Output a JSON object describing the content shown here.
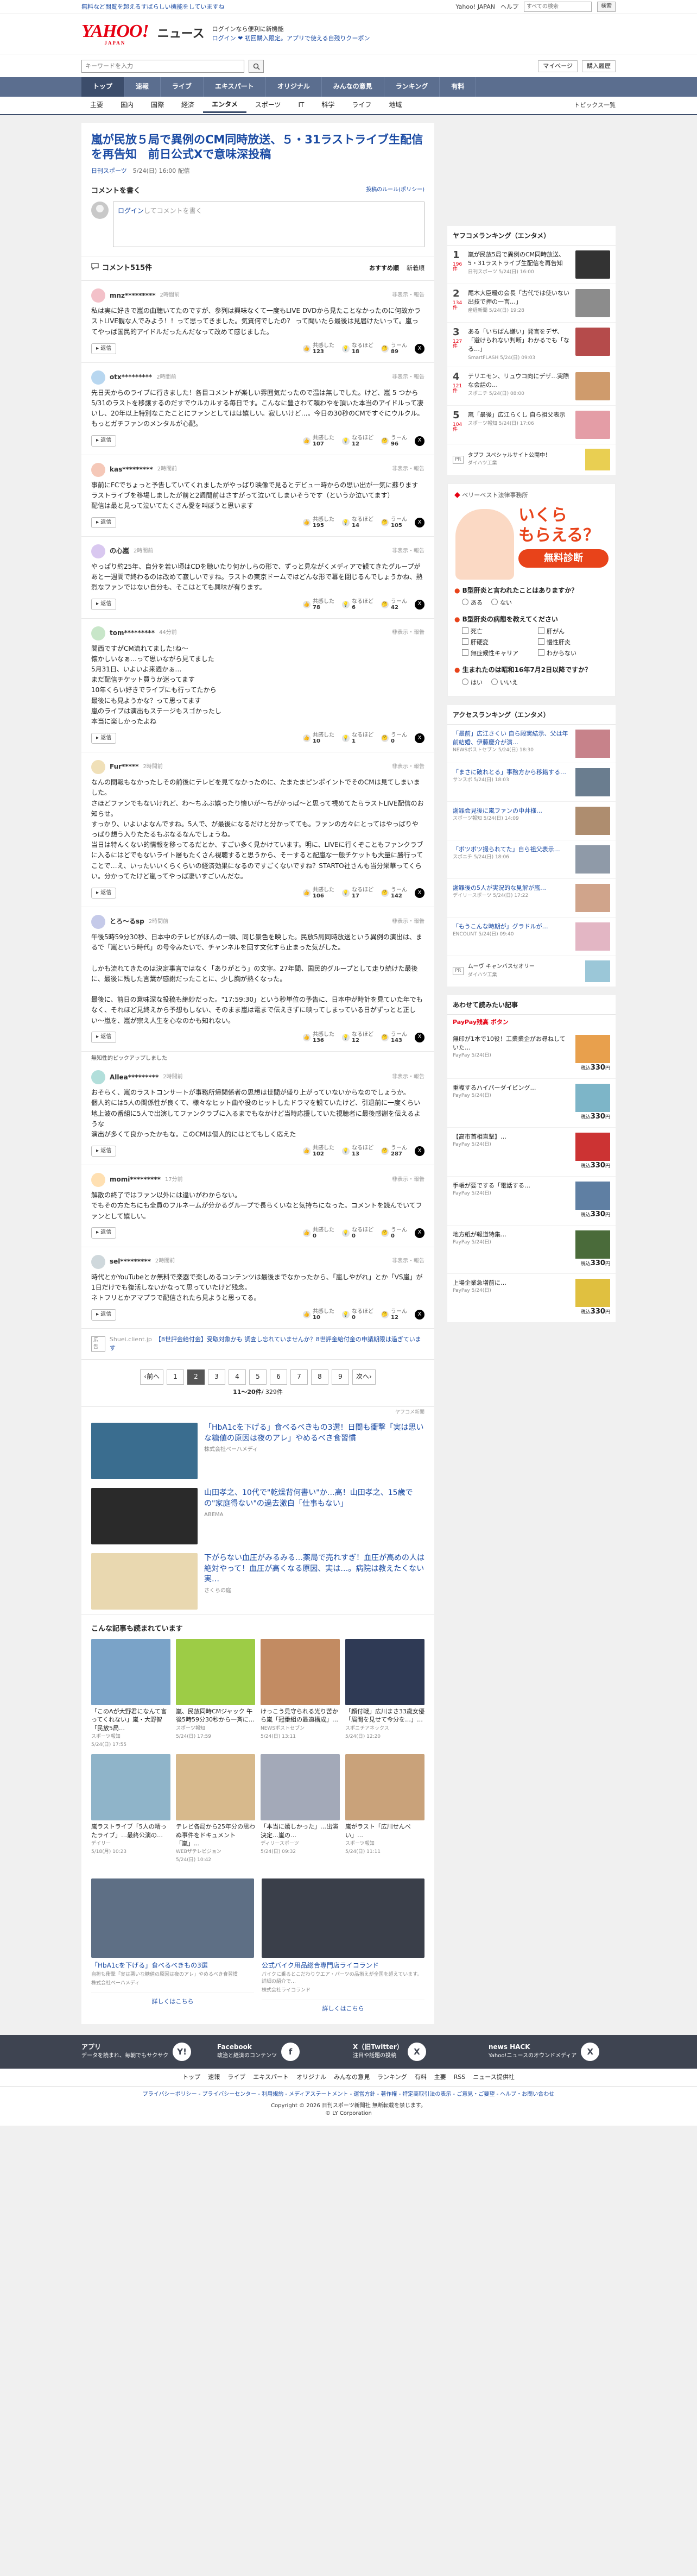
{
  "topbar": {
    "notice": "無料など閲覧を超えるすばらしい機能をしていますね",
    "links": [
      "Yahoo! JAPAN",
      "ヘルプ"
    ],
    "search_placeholder": "すべての検索",
    "search_button": "検索"
  },
  "header": {
    "logo": "YAHOO!",
    "logo_sub": "JAPAN",
    "section": "ニュース",
    "promo1": "ログインなら便利に新機能",
    "promo2": "ログイン ❤ 初回購入限定。アプリで使える自残りクーポン",
    "promo3": ""
  },
  "searchrow": {
    "placeholder": "キーワードを入力",
    "right": [
      "マイページ",
      "購入履歴"
    ]
  },
  "gnav": [
    "トップ",
    "速報",
    "ライブ",
    "エキスパート",
    "オリジナル",
    "みんなの意見",
    "ランキング",
    "有料"
  ],
  "snav": [
    "主要",
    "国内",
    "国際",
    "経済",
    "エンタメ",
    "スポーツ",
    "IT",
    "科学",
    "ライフ",
    "地域"
  ],
  "snav_right": "トピックス一覧",
  "article": {
    "title": "嵐が民放５局で異例のCM同時放送、５・31ラストライブ生配信を再告知　前日公式Xで意味深投稿",
    "source": "日刊スポーツ",
    "date": "5/24(日) 16:00 配信"
  },
  "comment_write": {
    "heading": "コメントを書く",
    "policy_link": "投稿のルール(ポリシー)",
    "login": "ログイン",
    "placeholder": "してコメントを書く"
  },
  "comments_head": {
    "count": "コメント515件",
    "sort": [
      "おすすめ順",
      "新着順"
    ]
  },
  "labels": {
    "reply": "返信",
    "report": "非表示・報告",
    "v1": "共感した",
    "v2": "なるほど",
    "v3": "うーん",
    "expert_note": "無知性的ピックアップしました"
  },
  "comments": [
    {
      "name": "mnz*********",
      "time": "2時間前",
      "text": "私は実に好きで嵐の曲聴いてたのですが、参列は興味なくて一度もLIVE DVDから見たことなかったのに何故かラストLIVE観な人でみよう！！って思ってきました。気質何でしたの？ って聞いたら最後は見届けたいって。嵐ってやっぱ国民的アイドルだったんだなって改めて感じました。",
      "v": [
        "123",
        "18",
        "89"
      ],
      "color": "#f3c1c9"
    },
    {
      "name": "otx*********",
      "time": "2時間前",
      "text": "先日天からのライブに行きました！各目コメントが楽しい雰囲気だったので温は無しでした。けど、嵐 5 つから5/31のラストを移譲するのだすでウルカルする毎日です。こんなに豊さわて頼わやを頂いた本当のアイドルって凄いし、20年以上特別なこたことにファンとしてはは嬉しい。寂しいけど…。今日の30秒のCMですぐにウルクル。もっとガチファンのメンタルが心配。",
      "v": [
        "107",
        "12",
        "96"
      ],
      "color": "#b8d7f0"
    },
    {
      "name": "kas*********",
      "time": "2時間前",
      "text": "事前にFCでちょっと予告していてくれましたがやっぱり映像で見るとデビュー時からの思い出が一気に蘇ります\nラストライブを移場しましたが前と2週間前はさすがって泣いてしまいそうです（というか泣いてます）\n配信は最と見って泣いてたくさん愛を叫ぼうと思います",
      "v": [
        "195",
        "14",
        "105"
      ],
      "color": "#f5c8b8"
    },
    {
      "name": "の心嵐",
      "time": "2時間前",
      "text": "やっぱり約25年、自分を若い頃はCDを聴いたり何かしらの形で、ずっと見ながくメディアで観てきたグループがあと一週間で終わるのは改めて寂しいですね。ラストの東京ドームではどんな形で幕を閉じるんでしょうかね、熱烈なファンではない自分も、そこはとても興味が有ります。",
      "v": [
        "78",
        "6",
        "42"
      ],
      "color": "#d9c8f0"
    },
    {
      "name": "tom*********",
      "time": "44分前",
      "text": "関西ですがCM流れてました!ね〜\n懐かしいなぁ…って思いながら見てました\n5月31日、いよいよ来週かぁ…\nまだ配信チケット買うか迷ってます\n10年くらい好きでライブにも行ってたから\n最後にも見ようかな？って思ってます\n嵐のライブは演出もステージもスゴかったし\n本当に楽しかったよね",
      "v": [
        "10",
        "1",
        "0"
      ],
      "color": "#c8e6c9"
    },
    {
      "name": "Fur*****",
      "time": "2時間前",
      "text": "なんの間報もなかったしその前後にテレビを見てなかったのに、たまたまピンポイントでそのCMは見てしまいました。\nさほどファンでもないけれど、わ〜ちふぶ嬉ったり懐いが〜ちがかっぱ〜と思って視めてたらラストLIVE配信のお知らせ。\nすっかり、いよいよなんですね。5人で、が最後になるだけと分かってても。ファンの方々にとってはやっぱりやっぱり想う入りたたるもぶなるなんでしょうね。\n当日は特んくない的情報を移ってるだとか、すごい多く見かけています。明に、LIVEに行くぞこともファンクラブに入るにはどでもないライト層もたくさん視聴すると思うから、そーすると配嵐な一般チケットも大量に勝行ってことで…え、いったいいくらくらいの経済効果になるのですごくないですね？STARTO社さんも当分栄華ってくらい。分かってたけど嵐ってやっぱ凄いすごいんだな。",
      "v": [
        "106",
        "17",
        "142"
      ],
      "color": "#f0e0b8"
    },
    {
      "name": "とろ〜るsp",
      "time": "2時間前",
      "text": "午後5時59分30秒、日本中のテレビがほんの一瞬、同じ景色を映した。民放5局同時放送という異例の演出は、まるで「嵐という時代」の号令みたいで、チャンネルを回す文化すら止まった気がした。\n\nしかも流れてきたのは決定事言ではなく「ありがとう」の文字。27年間、国民的グループとして走り続けた最後に、最後に残した言葉が感謝だったことに、少し胸が熱くなった。\n\n最後に、前日の意味深な投稿も絶妙だった。\"17:59:30」という秒単位の予告に、日本中が時計を見ていた年でもなく、それほど見終えから予想もしない、そのまま嵐は電まで伝えきずに映ってしまっている日がずっとと正しい〜嵐を、嵐が宗え人生を心なのかも知れない。",
      "v": [
        "136",
        "12",
        "143"
      ],
      "color": "#c5cae9"
    },
    {
      "name": "Allea*********",
      "time": "2時間前",
      "text": "おそらく、嵐のラストコンサートが事務所帰関係者の思想は世間が盛り上がっていないからなのでしょうか。\n個人的には5人の関係性が良くて、様々なヒット曲や役のヒットしたドラマを観ていたけど、引退前に一度くらい地上波の番組に5人で出演してファンクラブに入るまでもなかけど当時応援していた視聴者に最後感謝を伝えるような\n演出が多くて良かったかもな。このCMは個人的にはとてもしく応えた",
      "v": [
        "102",
        "13",
        "287"
      ],
      "color": "#b2dfdb"
    },
    {
      "name": "momi*********",
      "time": "17分前",
      "text": "解散の終了ではファン以外には違いがわからない。\nでもその方たちにも全員のフルネームが分かるグループで長らくいなと気持ちになった。コメントを読んでいてファンとして嬉しい。",
      "v": [
        "0",
        "0",
        "0"
      ],
      "color": "#ffe0b2"
    },
    {
      "name": "sel*********",
      "time": "2時間前",
      "text": "時代とかYouTubeとか無料で楽器で楽しめるコンテンツは最後までなかったから、「嵐しやがれ」とか「VS嵐」が1日だけでも復活しないかなって思っていたけど残念。\nネトフリとかアマプラで配信されたら見ようと思ってる。",
      "v": [
        "10",
        "0",
        "12"
      ],
      "color": "#cfd8dc"
    }
  ],
  "inline_ad": {
    "label": "Shuei.client.jp",
    "text": "【8世評金給付金】受取対象かも 調査し忘れていませんか？8世評金給付金の申請期限は過ぎています"
  },
  "pager": {
    "prev": "前へ",
    "next": "次へ",
    "pages": [
      "1",
      "2",
      "3",
      "4",
      "5",
      "6",
      "7",
      "8",
      "9"
    ],
    "current": "2",
    "count": "11〜20件",
    "total": "/ 329件"
  },
  "sponsored": {
    "label": "ヤフコメ新聞",
    "items": [
      {
        "title": "「HbA1cを下げる」食べるべきもの3選！日間も衝撃「実は思いな糖値の原因は夜のアレ」やめるべき食習慣",
        "src": "株式会社ベーハメディ",
        "color": "#3a6d8f"
      },
      {
        "title": "山田孝之、10代で\"乾燥背何書い\"か…高！山田孝之、15歳での\"家庭得ない\"の過去激白「仕事もない」",
        "src": "ABEMA",
        "color": "#2a2a2a"
      },
      {
        "title": "下がらない血圧がみるみる…薬局で売れすぎ！血圧が高めの人は絶対やって！血圧が高くなる原因、実は…。病院は教えたくない実…",
        "src": "さくらの庭",
        "color": "#e9d8b0"
      }
    ]
  },
  "more_head": "こんな記事も読まれています",
  "more_grid": [
    {
      "title": "「このAが大野君になんて言ってくれない」嵐・大野智「民放5局…",
      "src": "スポーツ報知",
      "date": "5/24(日) 17:55",
      "color": "#7aa3c8"
    },
    {
      "title": "嵐、民放同時CMジャック 午後5時59分30秒から一斉に…",
      "src": "スポーツ報知",
      "date": "5/24(日) 17:59",
      "color": "#9dcc46"
    },
    {
      "title": "けっこう見守られる光り苦から嵐「冠番組の最適構成」…",
      "src": "NEWSポストセブン",
      "date": "5/24(日) 13:11",
      "color": "#c28b62"
    },
    {
      "title": "「顔付戦」広川まさ33歳女優 「眉間を見せて今分を…」…",
      "src": "スポニチアネックス",
      "date": "5/24(日) 12:20",
      "color": "#2f3a55"
    },
    {
      "title": "嵐ラストライブ「5人の晴ったライブ」…最終公演の…",
      "src": "デイリー",
      "date": "5/18(月) 10:23",
      "color": "#8fb4c9"
    },
    {
      "title": "テレビ各局から25年分の思わぬ事件をドキュメント「嵐」…",
      "src": "WEBザテレビジョン",
      "date": "5/24(日) 10:42",
      "color": "#d7b98c"
    },
    {
      "title": "「本当に嬉しかった」…出演決定…嵐の…",
      "src": "ディリースポーツ",
      "date": "5/24(日) 09:32",
      "color": "#a3a9b8"
    },
    {
      "title": "嵐がラスト「広川せんべい」…",
      "src": "スポーツ報知",
      "date": "5/24(日) 11:11",
      "color": "#c9a27a"
    }
  ],
  "bottom_ads": [
    {
      "title": "「HbA1cを下げる」食べるべきもの3選",
      "desc": "自担も衝撃「実は悪いな糖値の原因は夜のアレ」やめるべき食習慣",
      "src": "株式会社ベーハメディ",
      "more": "詳しくはこちら",
      "color": "#5e6f85"
    },
    {
      "title": "公式バイク用品総合専門店ライコランド",
      "desc": "バイクに乗るとこだわりウエア・パーツの品揃えが全国を超えています。詳細の紹介で…",
      "src": "株式会社ライコランド",
      "more": "詳しくはこちら",
      "color": "#3a3f4a"
    }
  ],
  "ranking": {
    "title": "ヤフコメランキング（エンタメ）",
    "items": [
      {
        "n": "1",
        "cnt": "196件",
        "title": "嵐が民放5局で異例のCM同時放送、5・31ラストライブ生配信を再告知",
        "src": "日刊スポーツ 5/24(日) 16:00",
        "color": "#333333"
      },
      {
        "n": "2",
        "cnt": "134件",
        "title": "尾木大臣暖の会長「古代では使いない出技で押の一言…」",
        "src": "産経新聞 5/24(日) 19:28",
        "color": "#8c8c8c"
      },
      {
        "n": "3",
        "cnt": "127件",
        "title": "ある「いちばん嫌い」発言をデザ、「避けられない判断」わかるでも「なる…」",
        "src": "SmartFLASH 5/24(日) 09:03",
        "color": "#b54b4b"
      },
      {
        "n": "4",
        "cnt": "121件",
        "title": "テリエモン、リュウコ向にデザ…実際な会話の…",
        "src": "スポニチ 5/24(日) 08:00",
        "color": "#cf9b6c"
      },
      {
        "n": "5",
        "cnt": "104件",
        "title": "嵐「最後」広江らくし 自ら祖父表示",
        "src": "スポーツ報知 5/24(日) 17:06",
        "color": "#e49da6"
      }
    ],
    "pr": "タブフ スペシャルサイト公開中！",
    "pr_src": "ダイハツ工業"
  },
  "adbox": {
    "brand": "ベリーベスト法律事務所",
    "big1": "いくら",
    "big2": "もらえる？",
    "free": "無料診断",
    "q1": "B型肝炎と言われたことはありますか？",
    "q1_opts": [
      "ある",
      "ない"
    ],
    "q2": "B型肝炎の病態を教えてください",
    "q2_opts": [
      "死亡",
      "肝がん",
      "肝硬変",
      "慢性肝炎",
      "無症候性キャリア",
      "わからない"
    ],
    "q3": "生まれたのは昭和16年7月2日以降ですか？",
    "q3_opts": [
      "はい",
      "いいえ"
    ]
  },
  "access": {
    "title": "アクセスランキング（エンタメ）",
    "items": [
      {
        "title": "「最前」広江さくい 自ら殿実結示、父は年前結婚、伊藤慶介が演…",
        "src": "NEWSポストセブン 5/24(日) 18:30",
        "color": "#c7828a"
      },
      {
        "title": "「まさに破れとる」事務方から移籍する…",
        "src": "サンスポ 5/24(日) 18:03",
        "color": "#6a7d8f"
      },
      {
        "title": "謝罪会見後に嵐ファンの中井様…",
        "src": "スポーツ報知 5/24(日) 14:09",
        "color": "#ae8d6f"
      },
      {
        "title": "「ボツボツ撮られてた」自ら祖父表示…",
        "src": "スポニチ 5/24(日) 18:06",
        "color": "#8f9aa8"
      },
      {
        "title": "謝罪後の5人が実況的な見解が嵐…",
        "src": "デイリースポーツ 5/24(日) 17:22",
        "color": "#d0a48b"
      },
      {
        "title": "「もうこんな時期が」グラドルが…",
        "src": "ENCOUNT 5/24(日) 09:40",
        "color": "#e3b6c4"
      }
    ],
    "pr": "ムーヴ キャンバスセオリー",
    "pr_src": "ダイハツ工業"
  },
  "shop": {
    "title": "あわせて読みたい記事",
    "brand": "PayPay残高 ボタン",
    "items": [
      {
        "title": "無印が1本で10役！工業業企がお尋ねしていた…",
        "src": "PayPay 5/24(日)",
        "price": "330",
        "color": "#e8a04d"
      },
      {
        "title": "重複するハイパーダイビング…",
        "src": "PayPay 5/24(日)",
        "price": "330",
        "color": "#7db5c8"
      },
      {
        "title": "【高市首相直撃】…",
        "src": "PayPay 5/24(日)",
        "price": "330",
        "color": "#cc3333"
      },
      {
        "title": "手帳が要でする「電話する…",
        "src": "PayPay 5/24(日)",
        "price": "330",
        "color": "#5f7fa3"
      },
      {
        "title": "地方紙が報道特集…",
        "src": "PayPay 5/24(日)",
        "price": "330",
        "color": "#4a6b3a"
      },
      {
        "title": "上場企業急増前に…",
        "src": "PayPay 5/24(日)",
        "price": "330",
        "color": "#e0c040"
      }
    ],
    "unit": "税込"
  },
  "footer": {
    "apps": [
      {
        "icon": "Y!",
        "name": "アプリ",
        "desc": "データを読まれ、毎朝でもサクサク"
      },
      {
        "icon": "f",
        "name": "Facebook",
        "desc": "政治と経済のコンテンツ"
      },
      {
        "icon": "X",
        "name": "X（旧Twitter）",
        "desc": "注目や話題の投稿"
      },
      {
        "icon": "X",
        "name": "news HACK",
        "desc": "Yahoo!ニュースのオウンドメディア"
      }
    ],
    "nav": [
      "トップ",
      "速報",
      "ライブ",
      "エキスパート",
      "オリジナル",
      "みんなの意見",
      "ランキング",
      "有料",
      "主要",
      "RSS",
      "ニュース提供社"
    ],
    "legal": "プライバシーポリシー - プライバシーセンター - 利用規約 - メディアステートメント - 運営方針 - 著作権 - 特定商取引法の表示 - ご意見・ご要望 - ヘルプ・お問い合わせ",
    "copy": "Copyright © 2026 日刊スポーツ新聞社 無断転載を禁じます。",
    "copy2": "© LY Corporation"
  }
}
